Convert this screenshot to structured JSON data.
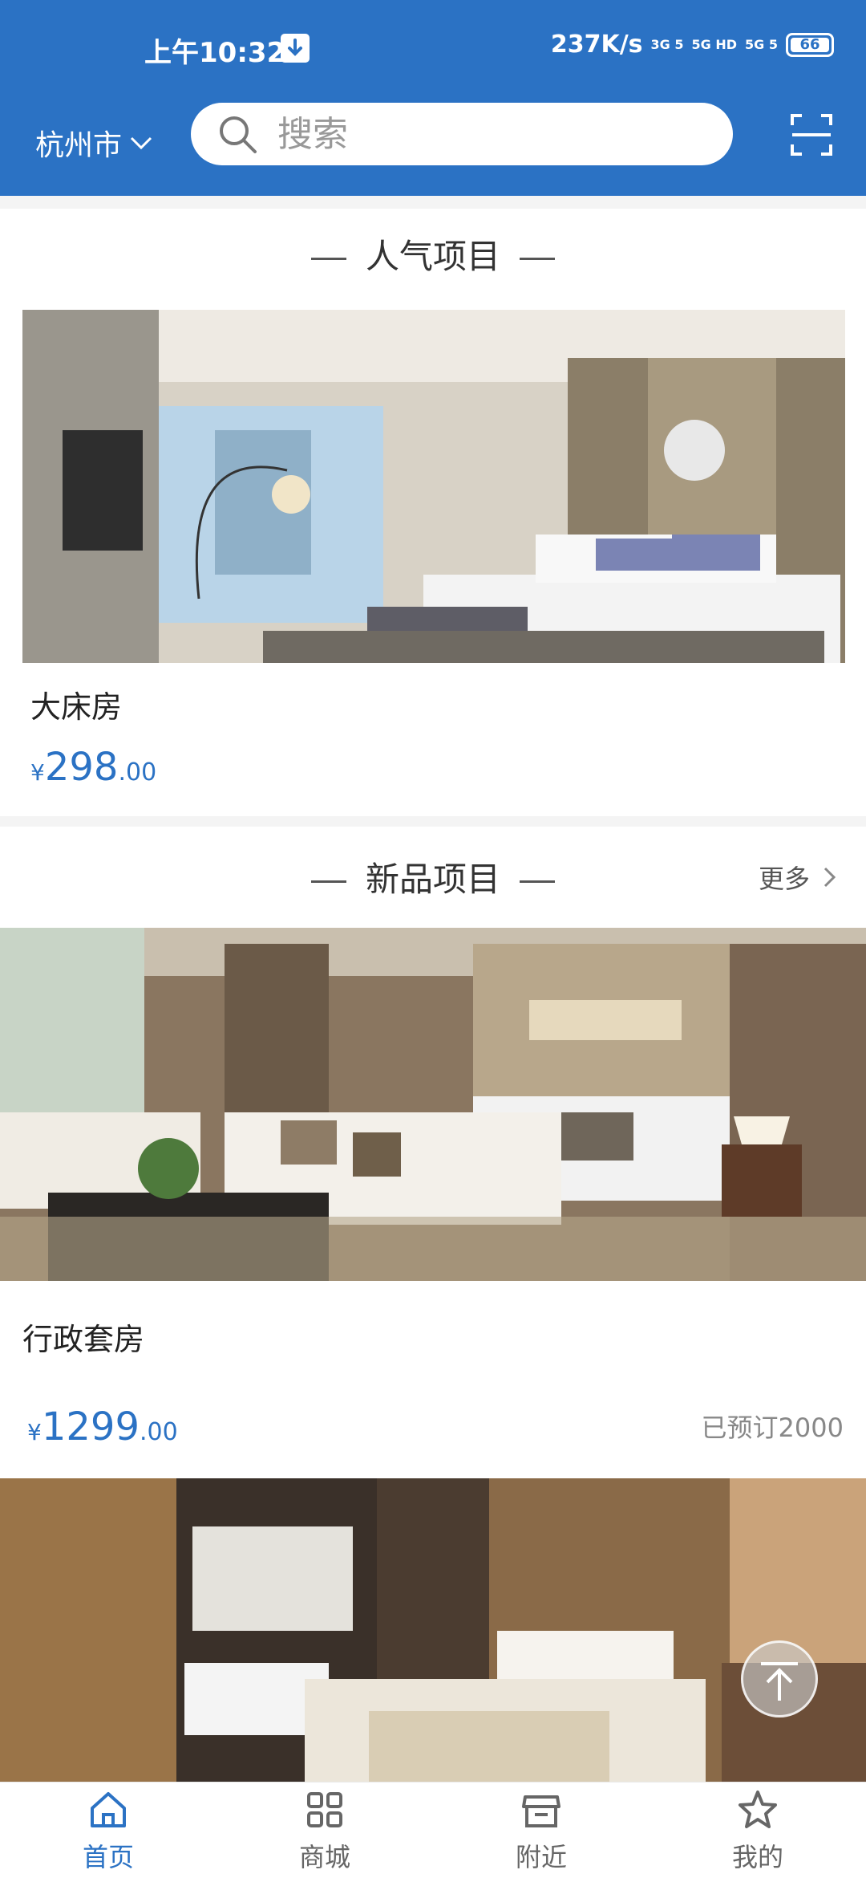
{
  "status_bar": {
    "time": "上午10:32",
    "speed": "237K/s",
    "signal_a": "3G 5",
    "signal_b": "5G HD",
    "signal_c": "5G 5",
    "battery": "66"
  },
  "header": {
    "city": "杭州市",
    "search_placeholder": "搜索",
    "accent_color": "#2b72c4"
  },
  "popular": {
    "title": "人气项目",
    "items": [
      {
        "name": "大床房",
        "currency": "¥",
        "price_int": "298",
        "price_dec": ".00"
      }
    ]
  },
  "new_items": {
    "title": "新品项目",
    "more_label": "更多",
    "items": [
      {
        "name": "行政套房",
        "currency": "¥",
        "price_int": "1299",
        "price_dec": ".00",
        "booked": "已预订2000"
      }
    ]
  },
  "bottom_nav": {
    "items": [
      {
        "label": "首页",
        "icon": "home-icon",
        "active": true
      },
      {
        "label": "商城",
        "icon": "grid-icon",
        "active": false
      },
      {
        "label": "附近",
        "icon": "store-icon",
        "active": false
      },
      {
        "label": "我的",
        "icon": "star-icon",
        "active": false
      }
    ]
  }
}
